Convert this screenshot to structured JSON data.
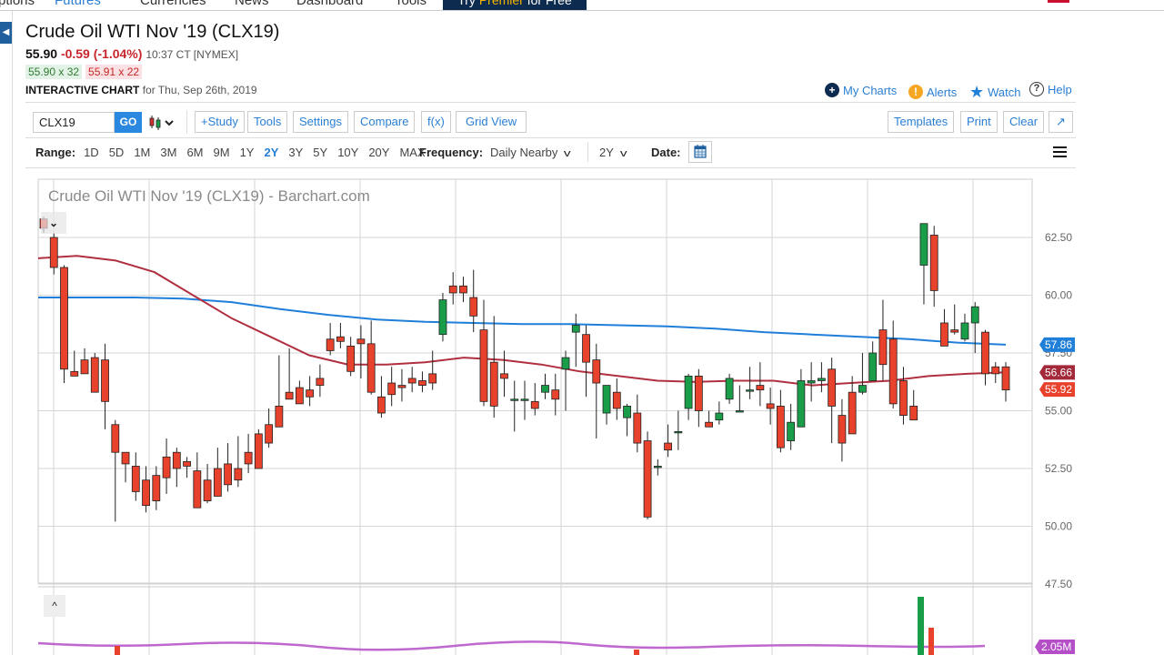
{
  "topnav": {
    "items": [
      "ptions",
      "Futures",
      "Currencies",
      "News",
      "Dashboard",
      "Tools"
    ],
    "active": "Futures",
    "premier": {
      "pre": "Try ",
      "gold": "Premier",
      "post": " for Free"
    }
  },
  "header": {
    "title": "Crude Oil WTI Nov '19 (CLX19)",
    "last": "55.90",
    "change": "-0.59 (-1.04%)",
    "time": "10:37 CT [NYMEX]",
    "bid": "55.90 x 32",
    "ask": "55.91 x 22",
    "chart_label": "INTERACTIVE CHART",
    "chart_for": "for Thu, Sep 26th, 2019"
  },
  "links": {
    "my_charts": "My Charts",
    "alerts": "Alerts",
    "watch": "Watch",
    "help": "Help"
  },
  "toolbar": {
    "symbol": "CLX19",
    "go": "GO",
    "study": "+Study",
    "tools": "Tools",
    "settings": "Settings",
    "compare": "Compare",
    "fx": "f(x)",
    "grid_view": "Grid View",
    "templates": "Templates",
    "print": "Print",
    "clear": "Clear",
    "expand": "↗"
  },
  "rangebar": {
    "label": "Range:",
    "ranges": [
      "1D",
      "5D",
      "1M",
      "3M",
      "6M",
      "9M",
      "1Y",
      "2Y",
      "3Y",
      "5Y",
      "10Y",
      "20Y",
      "MAX"
    ],
    "active": "2Y",
    "frequency_label": "Frequency:",
    "frequency": "Daily Nearby",
    "period": "2Y",
    "date_label": "Date:"
  },
  "colors": {
    "up": "#1a9d49",
    "down": "#e8412c",
    "ma_fast": "#b03040",
    "ma_slow": "#1f7fd9",
    "volume_avg": "#b44fc8",
    "accent": "#2a7fd4"
  },
  "chart_data": {
    "type": "candlestick",
    "title": "Crude Oil WTI Nov '19 (CLX19) - Barchart.com",
    "ylim": [
      46.6,
      63.9
    ],
    "yticks": [
      "62.50",
      "60.00",
      "57.50",
      "55.00",
      "52.50",
      "50.00",
      "47.50"
    ],
    "grid": true,
    "last_price_tags": [
      {
        "label": "57.86",
        "value": 57.86,
        "series": "ma_slow"
      },
      {
        "label": "56.66",
        "value": 56.66,
        "series": "ma_fast"
      },
      {
        "label": "55.92",
        "value": 55.92,
        "series": "price"
      }
    ],
    "candles": [
      [
        63.3,
        63.4,
        62.9,
        62.7
      ],
      [
        62.5,
        62.7,
        61.2,
        60.9
      ],
      [
        61.2,
        61.3,
        56.8,
        56.2
      ],
      [
        56.7,
        57.6,
        56.5,
        57.2
      ],
      [
        57.2,
        57.7,
        56.6,
        57.4
      ],
      [
        57.3,
        57.5,
        55.8,
        57.0
      ],
      [
        57.2,
        57.9,
        55.4,
        54.2
      ],
      [
        54.4,
        54.6,
        53.2,
        50.2
      ],
      [
        53.2,
        53.2,
        52.7,
        51.9
      ],
      [
        52.6,
        53.2,
        51.5,
        51.1
      ],
      [
        52.0,
        52.6,
        50.9,
        50.6
      ],
      [
        52.2,
        52.6,
        51.1,
        50.7
      ],
      [
        53.0,
        53.8,
        52.1,
        51.4
      ],
      [
        53.2,
        53.4,
        52.5,
        51.7
      ],
      [
        52.8,
        53.0,
        52.6,
        52.1
      ],
      [
        52.4,
        53.2,
        50.8,
        50.8
      ],
      [
        52.0,
        52.7,
        51.1,
        51.0
      ],
      [
        52.5,
        53.4,
        51.3,
        51.3
      ],
      [
        52.7,
        53.6,
        51.8,
        51.5
      ],
      [
        52.5,
        53.9,
        52.0,
        51.7
      ],
      [
        53.2,
        54.0,
        52.7,
        52.3
      ],
      [
        54.0,
        54.2,
        52.5,
        52.5
      ],
      [
        54.4,
        55.1,
        53.6,
        53.4
      ],
      [
        55.2,
        57.4,
        54.3,
        54.3
      ],
      [
        55.8,
        57.7,
        55.5,
        55.7
      ],
      [
        56.0,
        56.3,
        55.3,
        55.8
      ],
      [
        55.9,
        56.5,
        55.6,
        55.2
      ],
      [
        56.4,
        57.0,
        56.1,
        55.6
      ],
      [
        58.1,
        58.8,
        57.6,
        57.4
      ],
      [
        58.2,
        58.8,
        58.0,
        57.7
      ],
      [
        57.8,
        58.2,
        56.7,
        56.5
      ],
      [
        58.1,
        58.7,
        57.9,
        56.4
      ],
      [
        57.9,
        58.9,
        55.8,
        55.7
      ],
      [
        55.6,
        56.5,
        54.9,
        54.7
      ],
      [
        56.2,
        56.9,
        55.7,
        55.2
      ],
      [
        56.1,
        56.8,
        56.0,
        55.4
      ],
      [
        56.4,
        56.9,
        56.2,
        55.8
      ],
      [
        56.3,
        56.7,
        56.1,
        55.8
      ],
      [
        56.6,
        57.6,
        56.2,
        55.9
      ],
      [
        58.3,
        60.1,
        59.8,
        58.0
      ],
      [
        60.4,
        61.0,
        60.1,
        59.6
      ],
      [
        60.4,
        60.8,
        60.1,
        59.7
      ],
      [
        59.9,
        61.1,
        59.1,
        58.4
      ],
      [
        58.5,
        59.8,
        55.4,
        55.2
      ],
      [
        57.1,
        59.1,
        55.2,
        54.7
      ],
      [
        56.6,
        57.6,
        56.4,
        55.6
      ],
      [
        55.5,
        56.3,
        55.5,
        54.1
      ],
      [
        55.5,
        56.3,
        55.5,
        54.6
      ],
      [
        55.4,
        56.2,
        55.1,
        54.8
      ],
      [
        55.8,
        56.6,
        56.1,
        55.5
      ],
      [
        55.9,
        56.6,
        55.5,
        54.8
      ],
      [
        56.8,
        57.6,
        57.3,
        55.0
      ],
      [
        58.4,
        59.2,
        58.7,
        56.9
      ],
      [
        58.3,
        58.7,
        57.1,
        55.6
      ],
      [
        57.2,
        57.9,
        56.2,
        53.8
      ],
      [
        54.9,
        55.6,
        56.1,
        54.4
      ],
      [
        55.8,
        56.4,
        55.1,
        54.6
      ],
      [
        54.7,
        55.3,
        55.2,
        53.9
      ],
      [
        54.9,
        55.7,
        53.6,
        53.2
      ],
      [
        53.7,
        54.1,
        50.4,
        50.3
      ],
      [
        52.6,
        52.9,
        52.6,
        52.2
      ],
      [
        53.6,
        54.4,
        53.3,
        53.0
      ],
      [
        54.1,
        55.0,
        54.1,
        53.3
      ],
      [
        55.1,
        56.6,
        56.5,
        54.6
      ],
      [
        56.5,
        56.8,
        55.0,
        54.3
      ],
      [
        54.5,
        55.0,
        54.3,
        54.4
      ],
      [
        54.6,
        55.4,
        54.9,
        54.4
      ],
      [
        55.5,
        56.6,
        56.4,
        55.3
      ],
      [
        55.0,
        56.1,
        55.0,
        55.1
      ],
      [
        55.9,
        56.9,
        55.9,
        55.5
      ],
      [
        56.1,
        57.1,
        55.9,
        55.2
      ],
      [
        55.3,
        56.0,
        55.1,
        54.4
      ],
      [
        55.2,
        55.9,
        53.4,
        53.2
      ],
      [
        53.7,
        55.3,
        54.5,
        53.3
      ],
      [
        54.3,
        56.8,
        56.3,
        54.3
      ],
      [
        56.2,
        57.1,
        56.3,
        55.4
      ],
      [
        56.3,
        57.1,
        56.4,
        55.8
      ],
      [
        56.8,
        57.3,
        55.2,
        53.6
      ],
      [
        54.8,
        55.5,
        53.6,
        52.8
      ],
      [
        55.8,
        56.5,
        54.0,
        55.8
      ],
      [
        55.8,
        57.5,
        56.1,
        55.7
      ],
      [
        56.3,
        58.0,
        57.5,
        56.8
      ],
      [
        58.5,
        59.8,
        57.0,
        56.3
      ],
      [
        58.1,
        58.9,
        55.3,
        55.1
      ],
      [
        56.3,
        56.9,
        54.8,
        54.4
      ],
      [
        55.2,
        55.9,
        54.6,
        54.9
      ],
      [
        61.3,
        62.8,
        63.1,
        59.6
      ],
      [
        62.6,
        63.0,
        60.2,
        59.5
      ],
      [
        58.8,
        59.4,
        57.8,
        57.9
      ],
      [
        58.5,
        59.6,
        58.4,
        58.3
      ],
      [
        58.1,
        59.2,
        58.8,
        58.0
      ],
      [
        58.8,
        59.7,
        59.5,
        57.5
      ],
      [
        58.4,
        58.5,
        56.6,
        56.1
      ],
      [
        56.9,
        57.1,
        56.6,
        56.2
      ],
      [
        56.9,
        57.1,
        55.9,
        55.4
      ]
    ],
    "ma_slow": [
      59.9,
      59.9,
      59.9,
      59.85,
      59.7,
      59.4,
      59.15,
      58.95,
      58.85,
      58.8,
      58.75,
      58.75,
      58.7,
      58.65,
      58.55,
      58.4,
      58.3,
      58.2,
      58.1,
      57.95,
      57.86
    ],
    "ma_fast": [
      61.6,
      61.7,
      61.5,
      61.0,
      60.0,
      59.0,
      58.2,
      57.4,
      57.0,
      57.0,
      57.1,
      57.3,
      57.2,
      57.0,
      56.7,
      56.5,
      56.3,
      56.25,
      56.3,
      56.3,
      56.1,
      56.2,
      56.3,
      56.5,
      56.6,
      56.66
    ],
    "volume_avg_label": "2.05M"
  }
}
